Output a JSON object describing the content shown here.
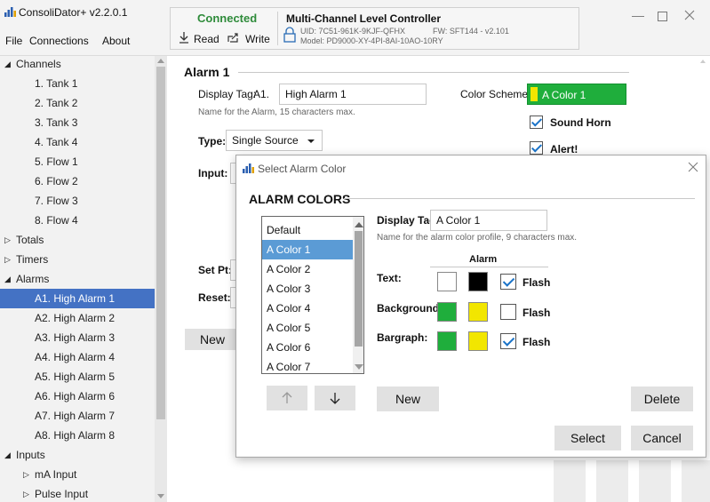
{
  "app": {
    "title": "ConsoliDator+ v2.2.0.1"
  },
  "menu": [
    "File",
    "Connections",
    "About"
  ],
  "status": {
    "connected": "Connected",
    "read": "Read",
    "write": "Write",
    "device_title": "Multi-Channel Level Controller",
    "uid": "UID: 7C51-961K-9KJF-QFHX",
    "fw": "FW: SFT144 - v2.101",
    "model": "Model: PD9000-XY-4PI-8AI-10AO-10RY"
  },
  "sidebar": {
    "items": [
      {
        "label": "Channels",
        "level": 0,
        "arrow": "◢"
      },
      {
        "label": "1. Tank 1",
        "level": 1
      },
      {
        "label": "2. Tank 2",
        "level": 1
      },
      {
        "label": "3. Tank  3",
        "level": 1
      },
      {
        "label": "4. Tank 4",
        "level": 1
      },
      {
        "label": "5. Flow 1",
        "level": 1
      },
      {
        "label": "6. Flow 2",
        "level": 1
      },
      {
        "label": "7. Flow 3",
        "level": 1
      },
      {
        "label": "8. Flow 4",
        "level": 1
      },
      {
        "label": "Totals",
        "level": 0,
        "arrow": "▷"
      },
      {
        "label": "Timers",
        "level": 0,
        "arrow": "▷"
      },
      {
        "label": "Alarms",
        "level": 0,
        "arrow": "◢"
      },
      {
        "label": "A1. High Alarm 1",
        "level": 1,
        "selected": true
      },
      {
        "label": "A2. High Alarm 2",
        "level": 1
      },
      {
        "label": "A3. High Alarm 3",
        "level": 1
      },
      {
        "label": "A4. High Alarm 4",
        "level": 1
      },
      {
        "label": "A5. High Alarm 5",
        "level": 1
      },
      {
        "label": "A6. High Alarm 6",
        "level": 1
      },
      {
        "label": "A7. High Alarm 7",
        "level": 1
      },
      {
        "label": "A8. High Alarm 8",
        "level": 1
      },
      {
        "label": "Inputs",
        "level": 0,
        "arrow": "◢"
      },
      {
        "label": "mA Input",
        "level": 1,
        "arrow": "▷"
      },
      {
        "label": "Pulse Input",
        "level": 1,
        "arrow": "▷"
      }
    ]
  },
  "alarm": {
    "heading": "Alarm 1",
    "display_tag_label": "Display Tag:",
    "display_tag_prefix": "A1.",
    "display_tag_value": "High Alarm 1",
    "tag_hint": "Name for the Alarm, 15 characters max.",
    "color_scheme_label": "Color Scheme:",
    "color_scheme_value": "A Color 1",
    "sound_horn": "Sound Horn",
    "alert": "Alert!",
    "type_label": "Type:",
    "type_value": "Single Source",
    "input_label": "Input:",
    "setpt_label": "Set Pt:",
    "reset_label": "Reset:",
    "new_button": "New"
  },
  "dialog": {
    "title": "Select Alarm Color",
    "heading": "ALARM COLORS",
    "list": [
      "Default",
      "A Color 1",
      "A Color 2",
      "A Color 3",
      "A Color 4",
      "A Color 5",
      "A Color 6",
      "A Color 7"
    ],
    "selected_index": 1,
    "display_tag_label": "Display Tag:",
    "display_tag_value": "A Color 1",
    "tag_hint": "Name for the alarm color profile, 9 characters max.",
    "alarm_col": "Alarm",
    "rows": [
      {
        "label": "Text:",
        "normal": "#ffffff",
        "alarm": "#000000",
        "flash": true
      },
      {
        "label": "Background:",
        "normal": "#1fae3c",
        "alarm": "#f2e600",
        "flash": false
      },
      {
        "label": "Bargraph:",
        "normal": "#1fae3c",
        "alarm": "#f2e600",
        "flash": true
      }
    ],
    "flash_label": "Flash",
    "new": "New",
    "delete": "Delete",
    "select": "Select",
    "cancel": "Cancel"
  },
  "colors": {
    "accent": "#4472c4",
    "selected_list": "#5b9bd5",
    "status_green": "#2e8b3a",
    "scheme_green": "#1fae3c",
    "scheme_yellow": "#f2e600"
  }
}
